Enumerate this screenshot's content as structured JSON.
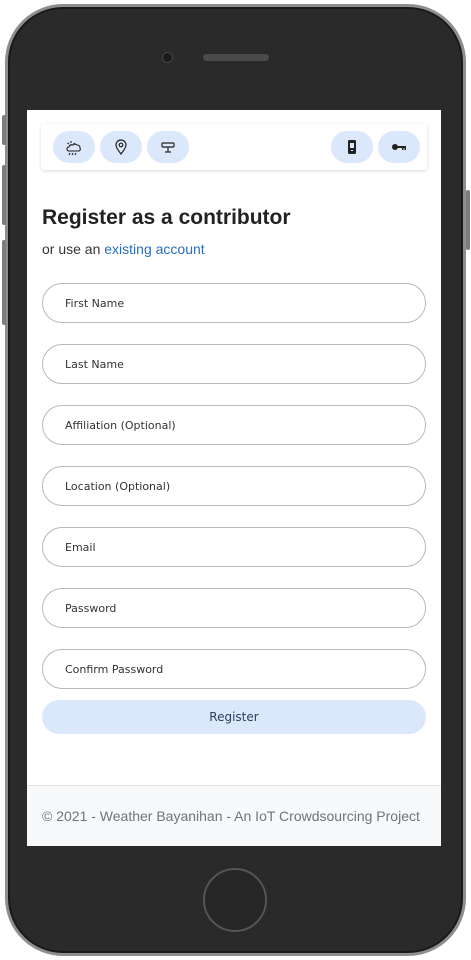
{
  "nav": {
    "left_icons": [
      "weather-icon",
      "location-pin-icon",
      "station-icon"
    ],
    "right_icons": [
      "phone-icon",
      "key-icon"
    ],
    "accent": "#dbe7fb"
  },
  "page": {
    "title": "Register as a contributor",
    "subtitle_prefix": "or use an ",
    "subtitle_link": "existing account",
    "link_color": "#2a6ebd"
  },
  "form": {
    "first_name_placeholder": "First Name",
    "last_name_placeholder": "Last Name",
    "affiliation_placeholder": "Affiliation (Optional)",
    "location_placeholder": "Location (Optional)",
    "email_placeholder": "Email",
    "password_placeholder": "Password",
    "confirm_password_placeholder": "Confirm Password",
    "register_label": "Register"
  },
  "footer": {
    "text": "© 2021 - Weather Bayanihan - An IoT Crowdsourcing Project"
  }
}
